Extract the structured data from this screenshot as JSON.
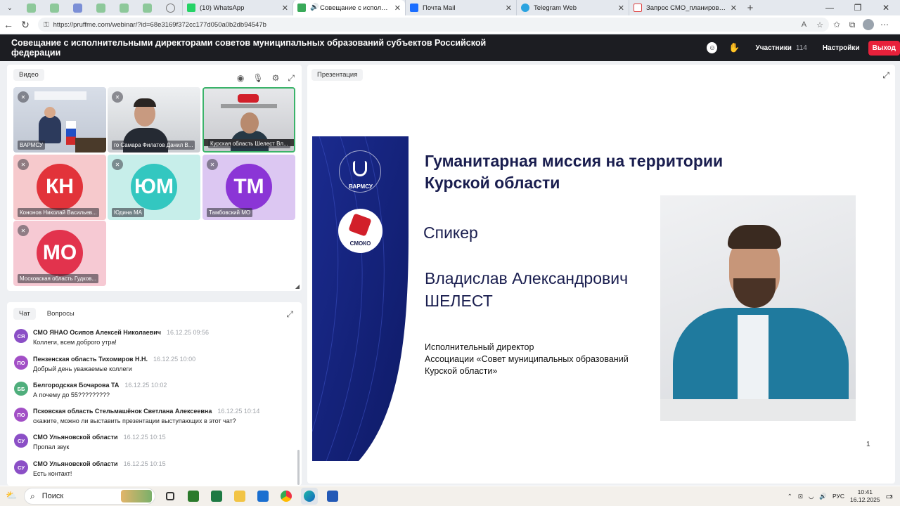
{
  "browser": {
    "tabs": [
      {
        "label": "(10) WhatsApp"
      },
      {
        "label": "Совещание с исполнительными"
      },
      {
        "label": "Почта Mail"
      },
      {
        "label": "Telegram Web"
      },
      {
        "label": "Запрос СМО_планирование янв"
      }
    ],
    "url": "https://pruffme.com/webinar/?id=68e3169f372cc177d050a0b2db94547b"
  },
  "header": {
    "title": "Совещание с исполнительными директорами советов муниципальных образований субъектов Российской федерации",
    "participants_label": "Участники",
    "participants_count": "114",
    "settings_label": "Настройки",
    "exit_label": "Выход"
  },
  "video": {
    "title": "Видео",
    "tiles": [
      {
        "name": "ВАРМСУ",
        "type": "camera"
      },
      {
        "name": "го Самара Филатов Данил В...",
        "type": "camera"
      },
      {
        "name": "Курская область Шелест Вл...",
        "type": "camera",
        "active": true
      },
      {
        "name": "Кононов Николай Васильев...",
        "initials": "КН",
        "color": "#e2333a"
      },
      {
        "name": "Юдина МА",
        "initials": "ЮМ",
        "color": "#33c7c0"
      },
      {
        "name": "Тамбовский МО",
        "initials": "ТМ",
        "color": "#8b35d6"
      },
      {
        "name": "Московская область Гудков...",
        "initials": "МО",
        "color": "#e2334d"
      }
    ]
  },
  "chat": {
    "tab_chat": "Чат",
    "tab_questions": "Вопросы",
    "messages": [
      {
        "initials": "СЯ",
        "author": "СМО ЯНАО Осипов Алексей Николаевич",
        "time": "16.12.25 09:56",
        "text": "Коллеги, всем доброго утра!",
        "color": "#8b4fc6"
      },
      {
        "initials": "ПО",
        "author": "Пензенская область Тихомиров Н.Н.",
        "time": "16.12.25 10:00",
        "text": "Добрый день уважаемые коллеги",
        "color": "#a24fc6"
      },
      {
        "initials": "ББ",
        "author": "Белгородская Бочарова ТА",
        "time": "16.12.25 10:02",
        "text": "А почему до 55?????????",
        "color": "#4fae7c"
      },
      {
        "initials": "ПО",
        "author": "Псковская область Стельмашёнок Светлана Алексеевна",
        "time": "16.12.25 10:14",
        "text": "скажите, можно ли выставить презентации выступающих в этот чат?",
        "color": "#a24fc6"
      },
      {
        "initials": "СУ",
        "author": "СМО Ульяновской области",
        "time": "16.12.25 10:15",
        "text": "Пропал звук",
        "color": "#8b4fc6"
      },
      {
        "initials": "СУ",
        "author": "СМО Ульяновской области",
        "time": "16.12.25 10:15",
        "text": "Есть контакт!",
        "color": "#8b4fc6"
      }
    ]
  },
  "presentation": {
    "title": "Презентация",
    "slide": {
      "logo1": "ВАРМСУ",
      "logo2": "СМОКО",
      "title_line1": "Гуманитарная миссия на территории",
      "title_line2": "Курской области",
      "speaker_label": "Спикер",
      "speaker_name_line1": "Владислав Александрович",
      "speaker_name_line2": "ШЕЛЕСТ",
      "role_line1": "Исполнительный директор",
      "role_line2": "Ассоциации «Совет муниципальных образований",
      "role_line3": "Курской области»",
      "page": "1"
    }
  },
  "taskbar": {
    "search_placeholder": "Поиск",
    "lang": "РУС",
    "time": "10:41",
    "date": "16.12.2025",
    "notif_count": "3"
  }
}
